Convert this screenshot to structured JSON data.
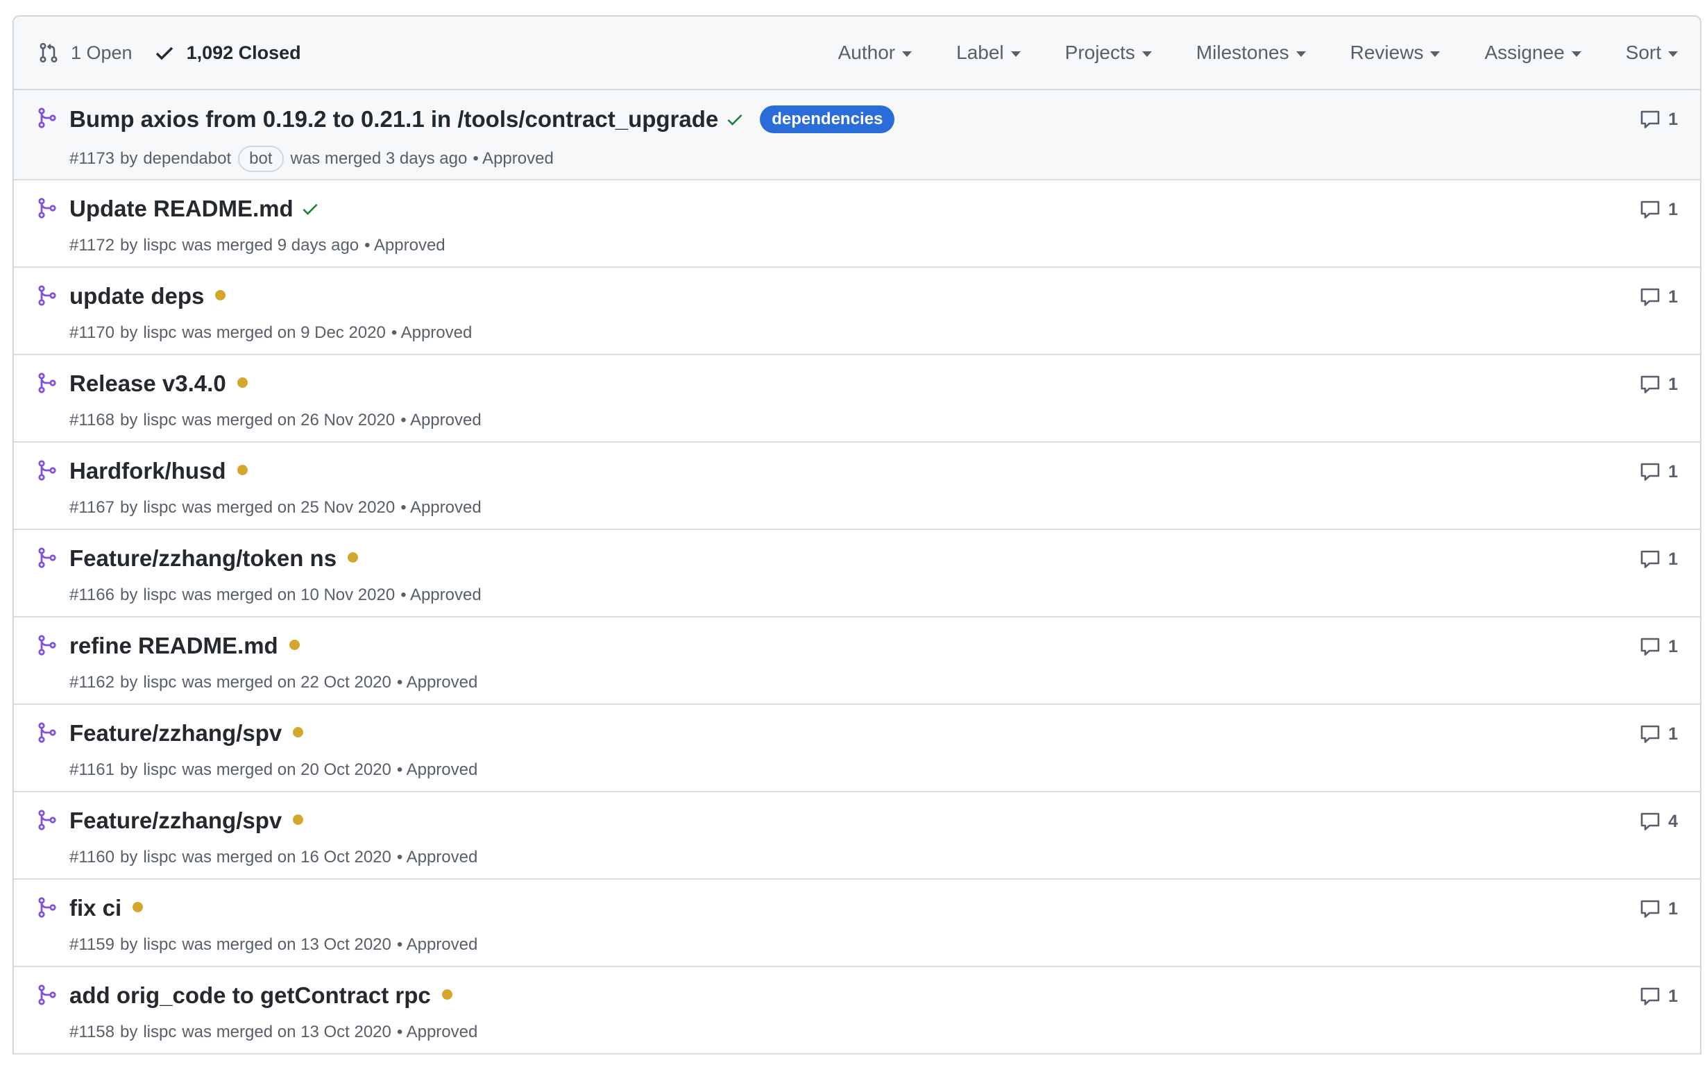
{
  "header": {
    "open_label": "1 Open",
    "closed_label": "1,092 Closed",
    "filters": [
      "Author",
      "Label",
      "Projects",
      "Milestones",
      "Reviews",
      "Assignee",
      "Sort"
    ]
  },
  "colors": {
    "merged_icon": "#8250df",
    "status_pending": "#d4a72c",
    "status_success": "#1a7f37",
    "label_dependencies": "#2a6dd8"
  },
  "pulls": [
    {
      "title": "Bump axios from 0.19.2 to 0.21.1 in /tools/contract_upgrade",
      "status": "success",
      "label": "dependencies",
      "number": "#1173",
      "by": "by",
      "author": "dependabot",
      "bot": "bot",
      "when": "was merged 3 days ago",
      "review": "• Approved",
      "comments": "1"
    },
    {
      "title": "Update README.md",
      "status": "success",
      "number": "#1172",
      "by": "by",
      "author": "lispc",
      "when": "was merged 9 days ago",
      "review": "• Approved",
      "comments": "1"
    },
    {
      "title": "update deps",
      "status": "pending",
      "number": "#1170",
      "by": "by",
      "author": "lispc",
      "when": "was merged on 9 Dec 2020",
      "review": "• Approved",
      "comments": "1"
    },
    {
      "title": "Release v3.4.0",
      "status": "pending",
      "number": "#1168",
      "by": "by",
      "author": "lispc",
      "when": "was merged on 26 Nov 2020",
      "review": "• Approved",
      "comments": "1"
    },
    {
      "title": "Hardfork/husd",
      "status": "pending",
      "number": "#1167",
      "by": "by",
      "author": "lispc",
      "when": "was merged on 25 Nov 2020",
      "review": "• Approved",
      "comments": "1"
    },
    {
      "title": "Feature/zzhang/token ns",
      "status": "pending",
      "number": "#1166",
      "by": "by",
      "author": "lispc",
      "when": "was merged on 10 Nov 2020",
      "review": "• Approved",
      "comments": "1"
    },
    {
      "title": "refine README.md",
      "status": "pending",
      "number": "#1162",
      "by": "by",
      "author": "lispc",
      "when": "was merged on 22 Oct 2020",
      "review": "• Approved",
      "comments": "1"
    },
    {
      "title": "Feature/zzhang/spv",
      "status": "pending",
      "number": "#1161",
      "by": "by",
      "author": "lispc",
      "when": "was merged on 20 Oct 2020",
      "review": "• Approved",
      "comments": "1"
    },
    {
      "title": "Feature/zzhang/spv",
      "status": "pending",
      "number": "#1160",
      "by": "by",
      "author": "lispc",
      "when": "was merged on 16 Oct 2020",
      "review": "• Approved",
      "comments": "4"
    },
    {
      "title": "fix ci",
      "status": "pending",
      "number": "#1159",
      "by": "by",
      "author": "lispc",
      "when": "was merged on 13 Oct 2020",
      "review": "• Approved",
      "comments": "1"
    },
    {
      "title": "add orig_code to getContract rpc",
      "status": "pending",
      "number": "#1158",
      "by": "by",
      "author": "lispc",
      "when": "was merged on 13 Oct 2020",
      "review": "• Approved",
      "comments": "1"
    }
  ]
}
